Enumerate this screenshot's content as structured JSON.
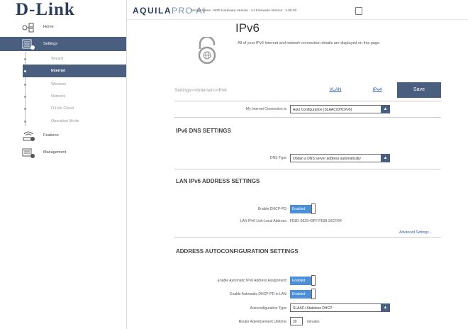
{
  "header": {
    "logo_text": "D-Link",
    "brand_main": "AQUILA",
    "brand_sub": "PRO AI",
    "info": "Model Name : M30 Hardware Version : A1 Firmware Version : 1.00.02"
  },
  "sidebar": {
    "items": [
      {
        "label": "Home",
        "icon": "home-network-icon"
      },
      {
        "label": "Settings",
        "icon": "settings-icon"
      },
      {
        "label": "Features",
        "icon": "features-icon"
      },
      {
        "label": "Management",
        "icon": "management-icon"
      }
    ],
    "subitems": [
      {
        "label": "Wizard"
      },
      {
        "label": "Internet"
      },
      {
        "label": "Wireless"
      },
      {
        "label": "Network"
      },
      {
        "label": "D-Link Cloud"
      },
      {
        "label": "Operation Mode"
      }
    ]
  },
  "page": {
    "title": "IPv6",
    "description": "All of your IPv6 Internet and network connection details are displayed on this page.",
    "breadcrumb": "Settings>>Internet>>IPv6",
    "tabs": {
      "vlan": "VLAN",
      "ipv4": "IPv4"
    },
    "save_label": "Save"
  },
  "connection": {
    "label": "My Internet Connection is:",
    "value": "Auto Configuration (SLAAC/DHCPv6)"
  },
  "dns": {
    "title": "IPv6 DNS SETTINGS",
    "type_label": "DNS Type:",
    "type_value": "Obtain a DNS server address automatically"
  },
  "lan": {
    "title": "LAN IPv6 ADDRESS SETTINGS",
    "dhcp_pd_label": "Enable DHCP-PD:",
    "dhcp_pd_value": "Enabled",
    "link_local_label": "LAN IPv6 Link-Local Address:",
    "link_local_value": "FE80::6629:43FF:FE99:16CF/64",
    "advanced_link": "Advanced Settings..."
  },
  "autoconf": {
    "title": "ADDRESS AUTOCONFIGURATION SETTINGS",
    "auto_assign_label": "Enable Automatic IPv6 Address Assignment:",
    "auto_assign_value": "Enabled",
    "auto_pd_label": "Enable Automatic DHCP-PD in LAN:",
    "auto_pd_value": "Enabled",
    "type_label": "Autoconfiguration Type:",
    "type_value": "SLAAC+Stateless DHCP",
    "lifetime_label": "Router Advertisement Lifetime:",
    "lifetime_value": "30",
    "lifetime_unit": "minutes"
  },
  "colors": {
    "accent": "#4a5f80",
    "toggle_on": "#4a8fd8",
    "link": "#2b5ea7"
  }
}
